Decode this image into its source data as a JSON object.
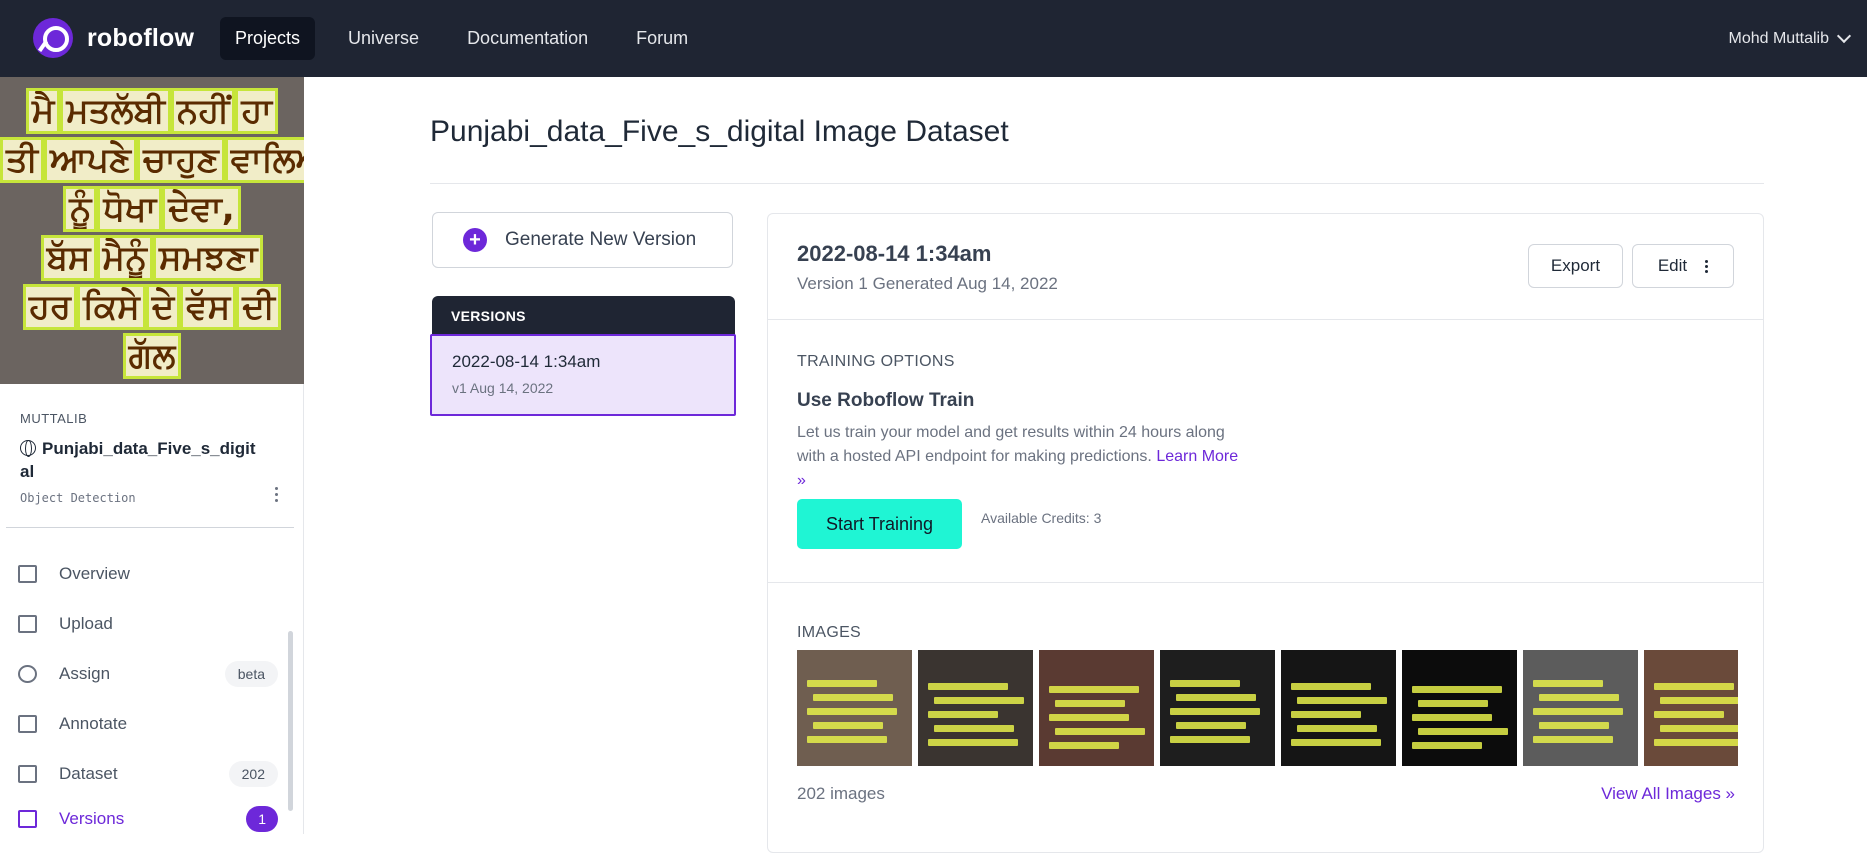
{
  "brand": {
    "name": "roboflow"
  },
  "nav": [
    {
      "label": "Projects",
      "active": true
    },
    {
      "label": "Universe",
      "active": false
    },
    {
      "label": "Documentation",
      "active": false
    },
    {
      "label": "Forum",
      "active": false
    }
  ],
  "user": {
    "name": "Mohd Muttalib"
  },
  "sidebar": {
    "owner": "MUTTALIB",
    "project_name": "Punjabi_data_Five_s_digit al",
    "project_type": "Object Detection",
    "thumb_lines": [
      [
        "ਮੈ",
        "ਮਤਲੱਬੀ",
        "ਨਹੀਂ",
        "ਹਾ"
      ],
      [
        "ਤੀ",
        "ਆਪਣੇ",
        "ਚਾਹੁਣ",
        "ਵਾਲਿਆ"
      ],
      [
        "ਨੂੰ",
        "ਧੋਖਾ",
        "ਦੇਵਾ,"
      ],
      [
        "ਬੱਸ",
        "ਮੈਨੂੰ",
        "ਸਮਝਣਾ"
      ],
      [
        "ਹਰ",
        "ਕਿਸੇ",
        "ਦੇ",
        "ਵੱਸ",
        "ਦੀ"
      ],
      [
        "ਗੱਲ"
      ]
    ],
    "menu": [
      {
        "label": "Overview",
        "icon": "document-icon",
        "badge": ""
      },
      {
        "label": "Upload",
        "icon": "upload-icon",
        "badge": ""
      },
      {
        "label": "Assign",
        "icon": "search-icon",
        "badge": "beta"
      },
      {
        "label": "Annotate",
        "icon": "annotate-icon",
        "badge": ""
      },
      {
        "label": "Dataset",
        "icon": "images-icon",
        "badge": "202"
      },
      {
        "label": "Versions",
        "icon": "folder-icon",
        "badge": "1",
        "active": true
      }
    ]
  },
  "main": {
    "title": "Punjabi_data_Five_s_digital Image Dataset",
    "generate_label": "Generate New Version",
    "versions_header": "VERSIONS",
    "version_card": {
      "title": "2022-08-14 1:34am",
      "subtitle": "v1 Aug 14, 2022"
    }
  },
  "panel": {
    "date": "2022-08-14 1:34am",
    "generated": "Version 1 Generated Aug 14, 2022",
    "export_label": "Export",
    "edit_label": "Edit",
    "training_label": "TRAINING OPTIONS",
    "train_title": "Use Roboflow Train",
    "train_desc": "Let us train your model and get results within 24 hours along with a hosted API endpoint for making predictions.",
    "learn_more": "Learn More »",
    "start_label": "Start Training",
    "credits": "Available Credits: 3",
    "images_label": "IMAGES",
    "image_count": "202 images",
    "view_all": "View All Images »",
    "tile_colors": [
      "#6f5e50",
      "#3a3430",
      "#5a3a32",
      "#1e1e1e",
      "#151515",
      "#0c0c0c",
      "#5c5c5c",
      "#6a4a3a"
    ]
  }
}
